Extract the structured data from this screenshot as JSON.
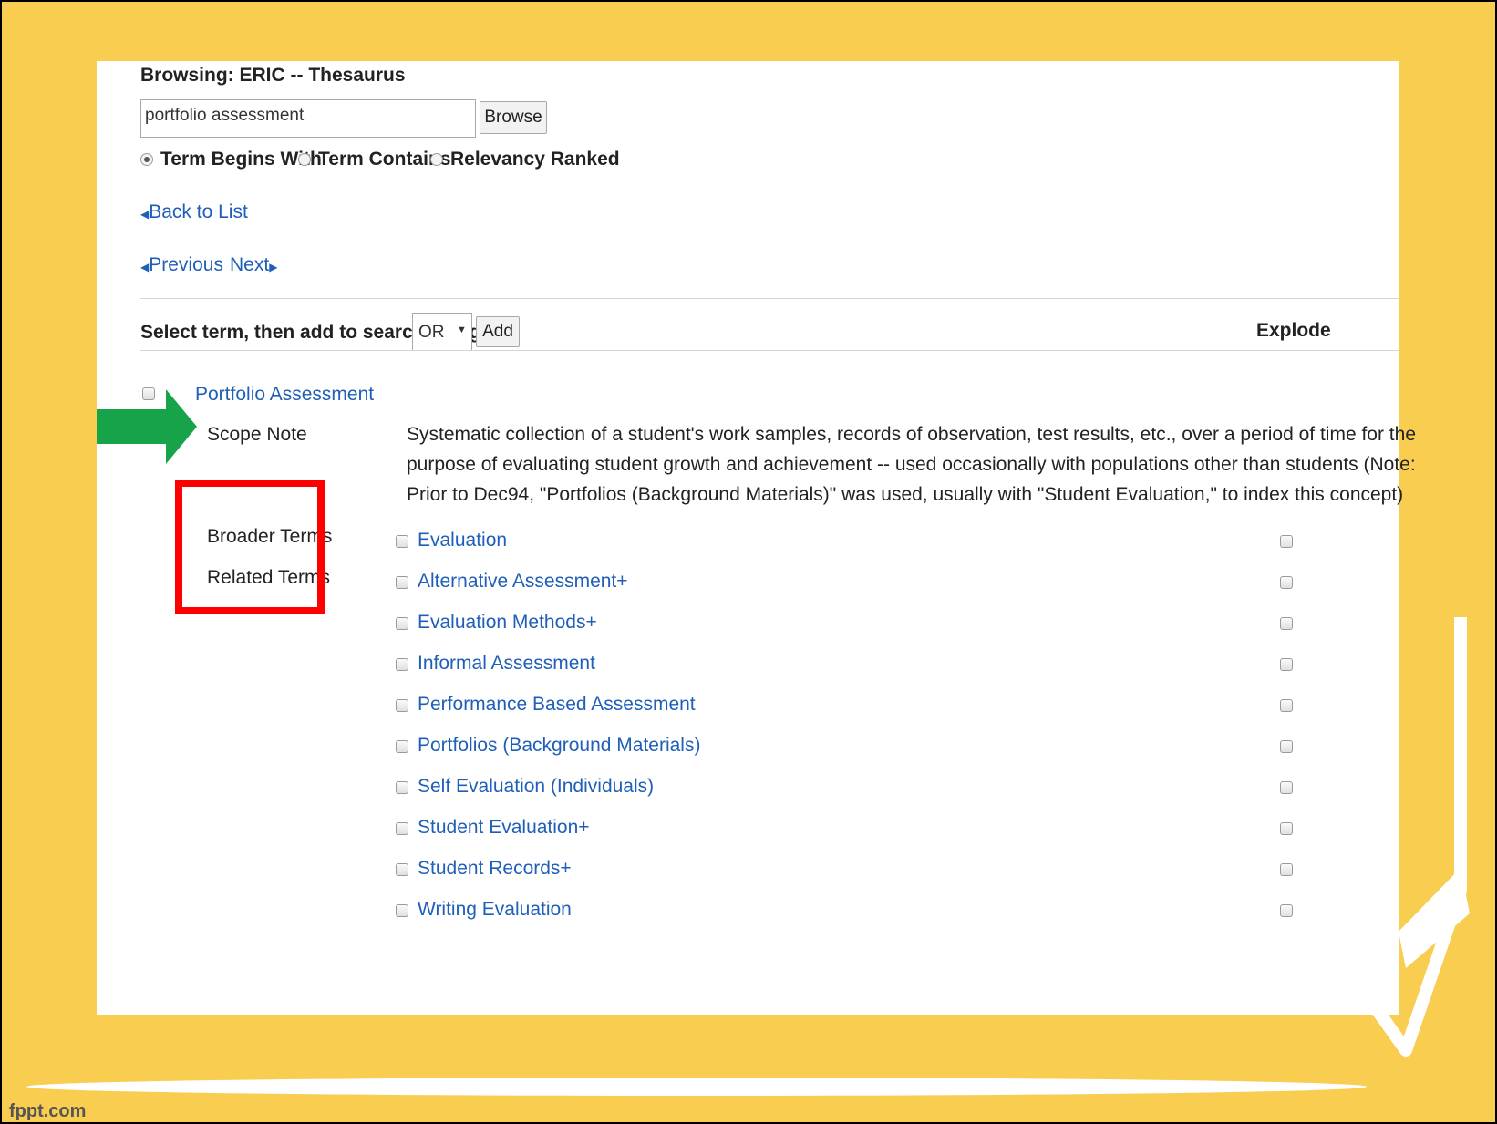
{
  "header": {
    "browsing_title": "Browsing: ERIC -- Thesaurus"
  },
  "search": {
    "value": "portfolio assessment",
    "browse_label": "Browse"
  },
  "search_mode": [
    {
      "label": "Term Begins With",
      "selected": true
    },
    {
      "label": "Term Contains",
      "selected": false
    },
    {
      "label": "Relevancy Ranked",
      "selected": false
    }
  ],
  "nav": {
    "back_to_list": "Back to List",
    "previous": "Previous",
    "next": "Next"
  },
  "add_bar": {
    "label": "Select term, then add to search using:",
    "operator": "OR",
    "add_label": "Add",
    "explode_header": "Explode"
  },
  "term": {
    "title": "Portfolio Assessment",
    "scope_note_label": "Scope Note",
    "scope_note_lines": [
      "Systematic collection of a student's work samples, records of observation, test results, etc., over a period of time for the",
      "purpose of evaluating student growth and achievement -- used occasionally with populations other than students (Note:",
      "Prior to Dec94, \"Portfolios (Background Materials)\" was used, usually with \"Student Evaluation,\" to index this concept)"
    ],
    "broader_terms_label": "Broader Terms",
    "related_terms_label": "Related Terms",
    "terms": [
      "Evaluation",
      "Alternative Assessment+",
      "Evaluation Methods+",
      "Informal Assessment",
      "Performance Based Assessment",
      "Portfolios (Background Materials)",
      "Self Evaluation (Individuals)",
      "Student Evaluation+",
      "Student Records+",
      "Writing Evaluation"
    ]
  },
  "footer": {
    "brand": "fppt.com"
  },
  "colors": {
    "background": "#f8cd50",
    "highlight_box": "#ff0000",
    "arrow": "#16a34a",
    "link": "#1f5fb8"
  }
}
